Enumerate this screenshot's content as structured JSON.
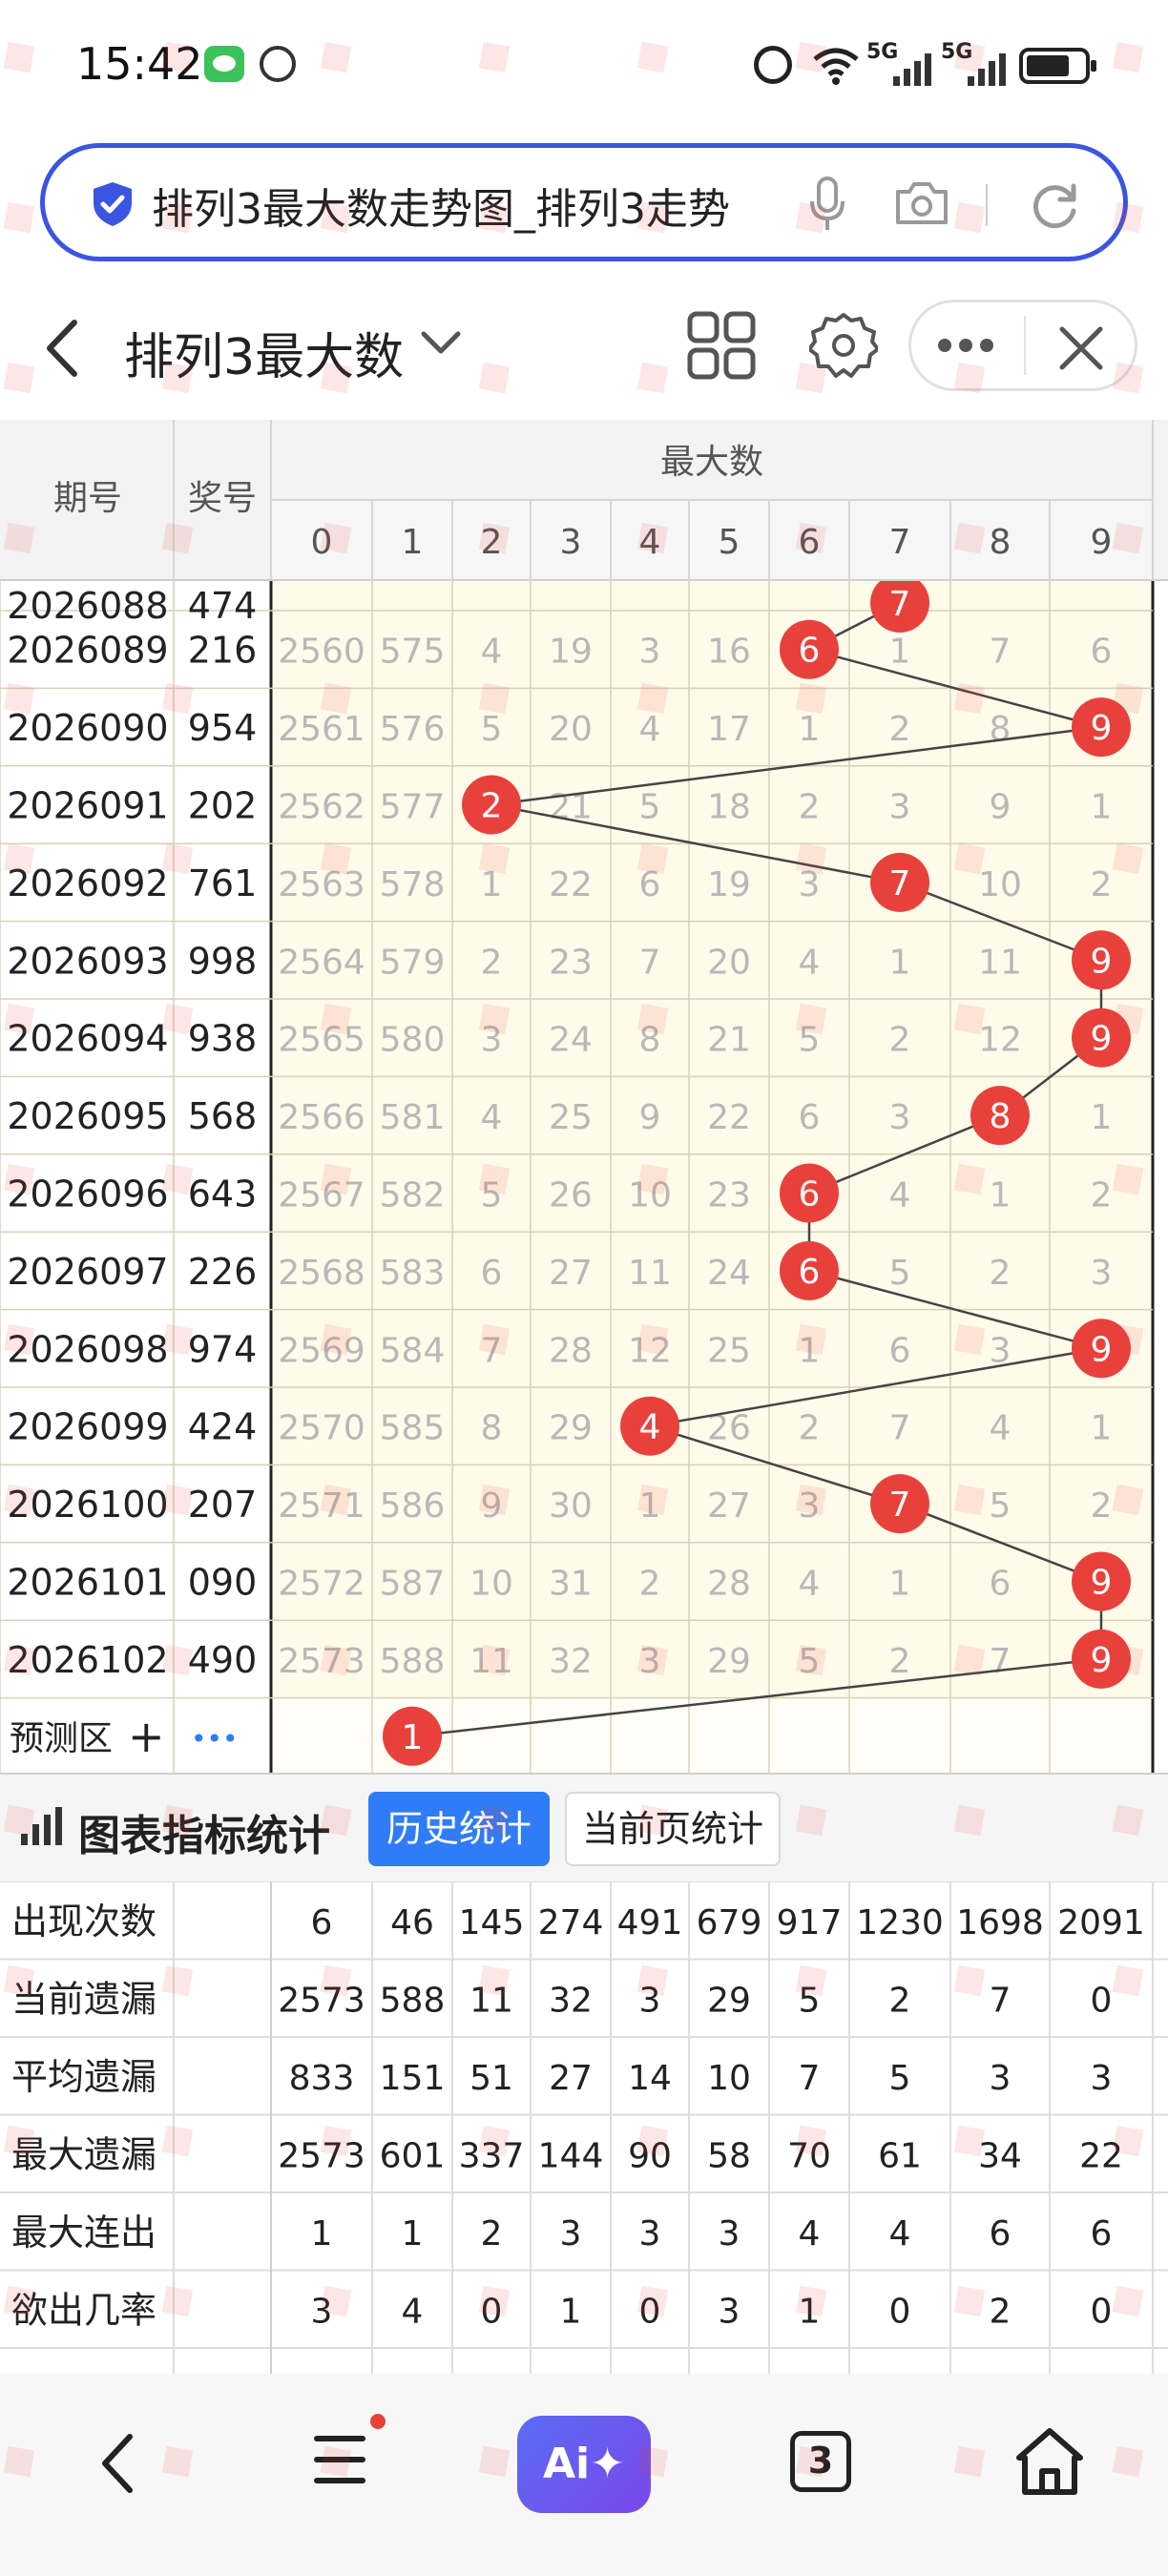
{
  "status_bar": {
    "time": "15:42",
    "net1": "5G",
    "net2": "5G"
  },
  "search": {
    "query": "排列3最大数走势图_排列3走势"
  },
  "header": {
    "title": "排列3最大数"
  },
  "trend_table": {
    "col_period": "期号",
    "col_draw": "奖号",
    "group_header": "最大数",
    "digits": [
      "0",
      "1",
      "2",
      "3",
      "4",
      "5",
      "6",
      "7",
      "8",
      "9"
    ],
    "partial_top_row": {
      "period": "2026088",
      "draw": "474",
      "winner": 7
    },
    "rows": [
      {
        "period": "2026089",
        "draw": "216",
        "winner": 6,
        "cells": [
          "2560",
          "575",
          "4",
          "19",
          "3",
          "16",
          "",
          "1",
          "7",
          "6"
        ]
      },
      {
        "period": "2026090",
        "draw": "954",
        "winner": 9,
        "cells": [
          "2561",
          "576",
          "5",
          "20",
          "4",
          "17",
          "1",
          "2",
          "8",
          ""
        ]
      },
      {
        "period": "2026091",
        "draw": "202",
        "winner": 2,
        "cells": [
          "2562",
          "577",
          "",
          "21",
          "5",
          "18",
          "2",
          "3",
          "9",
          "1"
        ]
      },
      {
        "period": "2026092",
        "draw": "761",
        "winner": 7,
        "cells": [
          "2563",
          "578",
          "1",
          "22",
          "6",
          "19",
          "3",
          "",
          "10",
          "2"
        ]
      },
      {
        "period": "2026093",
        "draw": "998",
        "winner": 9,
        "cells": [
          "2564",
          "579",
          "2",
          "23",
          "7",
          "20",
          "4",
          "1",
          "11",
          ""
        ]
      },
      {
        "period": "2026094",
        "draw": "938",
        "winner": 9,
        "cells": [
          "2565",
          "580",
          "3",
          "24",
          "8",
          "21",
          "5",
          "2",
          "12",
          ""
        ]
      },
      {
        "period": "2026095",
        "draw": "568",
        "winner": 8,
        "cells": [
          "2566",
          "581",
          "4",
          "25",
          "9",
          "22",
          "6",
          "3",
          "",
          "1"
        ]
      },
      {
        "period": "2026096",
        "draw": "643",
        "winner": 6,
        "cells": [
          "2567",
          "582",
          "5",
          "26",
          "10",
          "23",
          "",
          "4",
          "1",
          "2"
        ]
      },
      {
        "period": "2026097",
        "draw": "226",
        "winner": 6,
        "cells": [
          "2568",
          "583",
          "6",
          "27",
          "11",
          "24",
          "",
          "5",
          "2",
          "3"
        ]
      },
      {
        "period": "2026098",
        "draw": "974",
        "winner": 9,
        "cells": [
          "2569",
          "584",
          "7",
          "28",
          "12",
          "25",
          "1",
          "6",
          "3",
          ""
        ]
      },
      {
        "period": "2026099",
        "draw": "424",
        "winner": 4,
        "cells": [
          "2570",
          "585",
          "8",
          "29",
          "",
          "26",
          "2",
          "7",
          "4",
          "1"
        ]
      },
      {
        "period": "2026100",
        "draw": "207",
        "winner": 7,
        "cells": [
          "2571",
          "586",
          "9",
          "30",
          "1",
          "27",
          "3",
          "",
          "5",
          "2"
        ]
      },
      {
        "period": "2026101",
        "draw": "090",
        "winner": 9,
        "cells": [
          "2572",
          "587",
          "10",
          "31",
          "2",
          "28",
          "4",
          "1",
          "6",
          ""
        ]
      },
      {
        "period": "2026102",
        "draw": "490",
        "winner": 9,
        "cells": [
          "2573",
          "588",
          "11",
          "32",
          "3",
          "29",
          "5",
          "2",
          "7",
          ""
        ]
      }
    ],
    "prediction": {
      "label": "预测区",
      "plus": "+",
      "dots": "•••",
      "value": 1
    }
  },
  "stats": {
    "title": "图表指标统计",
    "tab_history": "历史统计",
    "tab_current": "当前页统计",
    "rows": [
      {
        "label": "出现次数",
        "values": [
          "6",
          "46",
          "145",
          "274",
          "491",
          "679",
          "917",
          "1230",
          "1698",
          "2091"
        ]
      },
      {
        "label": "当前遗漏",
        "values": [
          "2573",
          "588",
          "11",
          "32",
          "3",
          "29",
          "5",
          "2",
          "7",
          "0"
        ]
      },
      {
        "label": "平均遗漏",
        "values": [
          "833",
          "151",
          "51",
          "27",
          "14",
          "10",
          "7",
          "5",
          "3",
          "3"
        ]
      },
      {
        "label": "最大遗漏",
        "values": [
          "2573",
          "601",
          "337",
          "144",
          "90",
          "58",
          "70",
          "61",
          "34",
          "22"
        ]
      },
      {
        "label": "最大连出",
        "values": [
          "1",
          "1",
          "2",
          "3",
          "3",
          "3",
          "4",
          "4",
          "6",
          "6"
        ]
      },
      {
        "label": "欲出几率",
        "values": [
          "3",
          "4",
          "0",
          "1",
          "0",
          "3",
          "1",
          "0",
          "2",
          "0"
        ]
      }
    ]
  },
  "bottom_nav": {
    "ai_label": "Ai✦",
    "tabs_count": "3"
  },
  "colors": {
    "accent_blue": "#3a55e0",
    "ball_red": "#e8413c",
    "cell_bg": "#fffbea",
    "tab_active": "#2f7cf6"
  }
}
